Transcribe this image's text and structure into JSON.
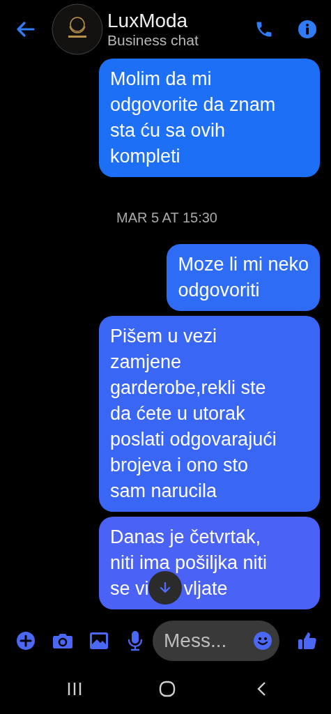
{
  "header": {
    "title": "LuxModa",
    "subtitle": "Business chat"
  },
  "messages": [
    {
      "kind": "bubble",
      "lines": [
        "Molim da mi",
        "odgovorite da znam",
        "sta ću sa ovih",
        "kompleti"
      ]
    },
    {
      "kind": "timestamp",
      "text": "MAR 5 AT 15:30"
    },
    {
      "kind": "bubble",
      "lines": [
        "Moze li mi neko",
        "odgovoriti"
      ]
    },
    {
      "kind": "bubble",
      "lines": [
        "Pišem u vezi",
        "zamjene",
        "garderobe,rekli ste",
        "da ćete u utorak",
        "poslati odgovarajući",
        "brojeva i ono sto",
        "sam narucila"
      ]
    },
    {
      "kind": "bubble",
      "lines": [
        "Danas je četvrtak,",
        "niti ima pošiljka niti",
        [
          "se vi",
          "vljate"
        ]
      ]
    }
  ],
  "composer": {
    "placeholder": "Mess..."
  }
}
